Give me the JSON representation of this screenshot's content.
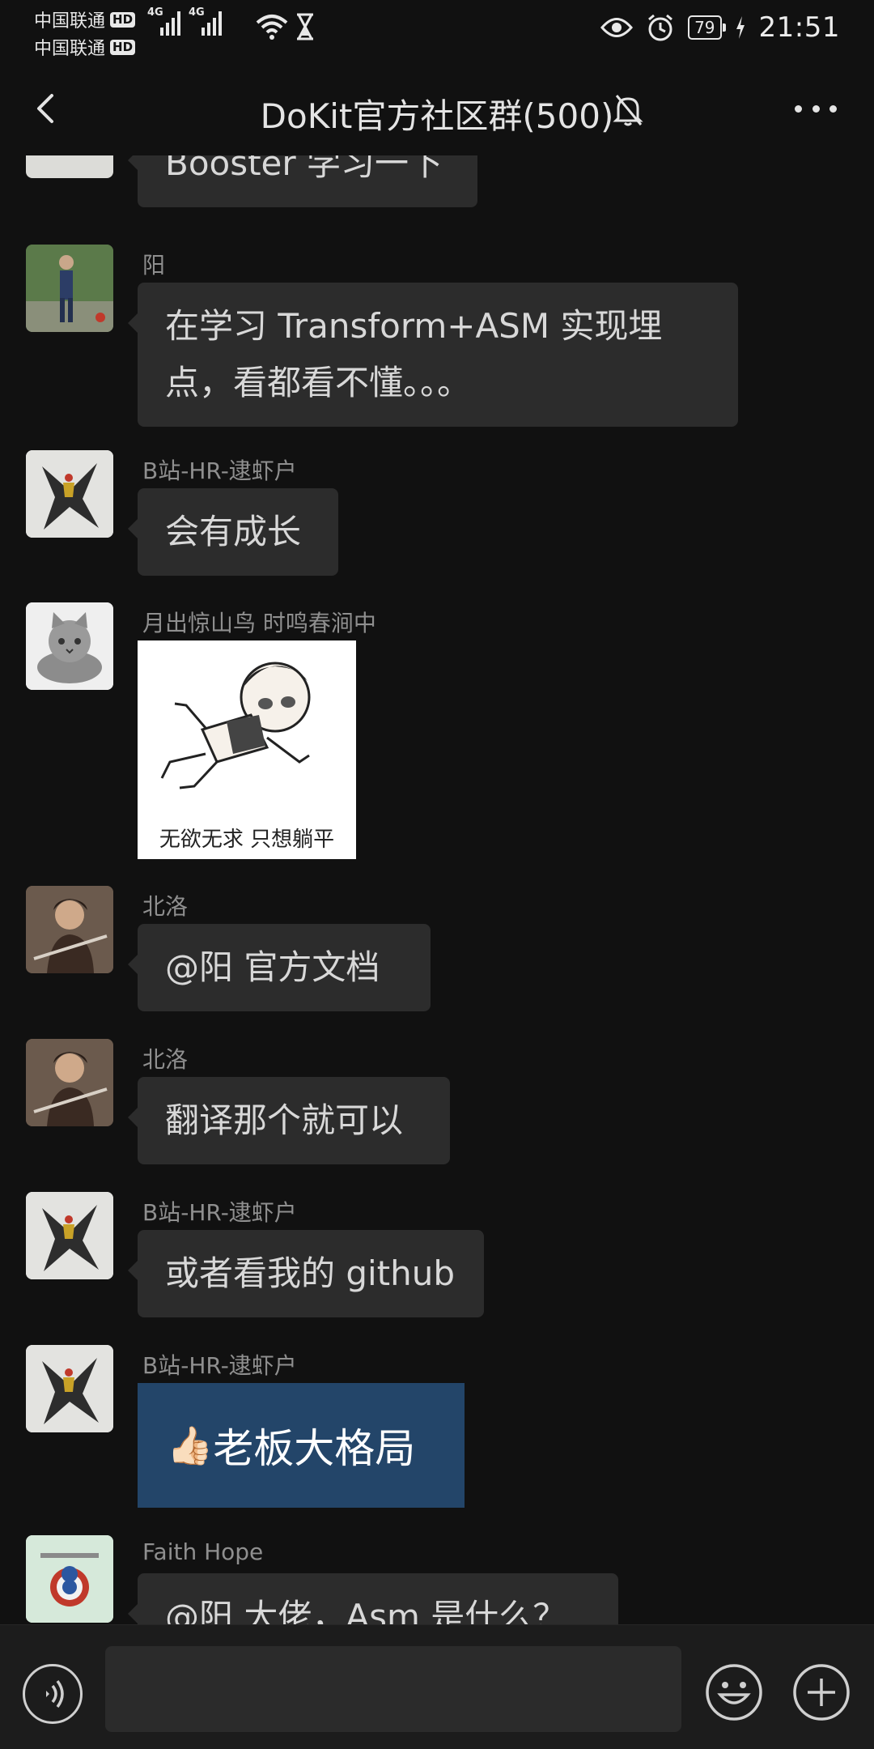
{
  "status_bar": {
    "carrier1": "中国联通",
    "carrier2": "中国联通",
    "hd_badge": "HD",
    "network_tag": "4G",
    "battery_level": "79",
    "time": "21:51"
  },
  "header": {
    "title": "DoKit官方社区群(500)"
  },
  "messages": [
    {
      "sender": "",
      "text": "Booster 学习一下",
      "avatar_icon": "avatar-partial-icon"
    },
    {
      "sender": "阳",
      "text": "在学习 Transform+ASM 实现埋点，看都看不懂。。。",
      "avatar_icon": "person-photo-icon"
    },
    {
      "sender": "B站-HR-逮虾户",
      "text": "会有成长",
      "avatar_icon": "mecha-robot-icon"
    },
    {
      "sender": "月出惊山鸟  时鸣春涧中",
      "text": "",
      "sticker_caption": "无欲无求 只想躺平",
      "avatar_icon": "cat-icon"
    },
    {
      "sender": "北洛",
      "text": "@阳  官方文档",
      "avatar_icon": "game-character-icon"
    },
    {
      "sender": "北洛",
      "text": "翻译那个就可以",
      "avatar_icon": "game-character-icon"
    },
    {
      "sender": "B站-HR-逮虾户",
      "text": "或者看我的 github",
      "avatar_icon": "mecha-robot-icon"
    },
    {
      "sender": "B站-HR-逮虾户",
      "text": "老板大格局",
      "emoji": "👍🏻",
      "avatar_icon": "mecha-robot-icon"
    },
    {
      "sender": "Faith Hope",
      "text": "@阳  大佬，Asm 是什么？",
      "avatar_icon": "captain-cartoon-icon"
    }
  ],
  "colors": {
    "background": "#111111",
    "bubble": "#2c2c2c",
    "blue_card": "#234569",
    "input_bar": "#1c1c1c"
  }
}
